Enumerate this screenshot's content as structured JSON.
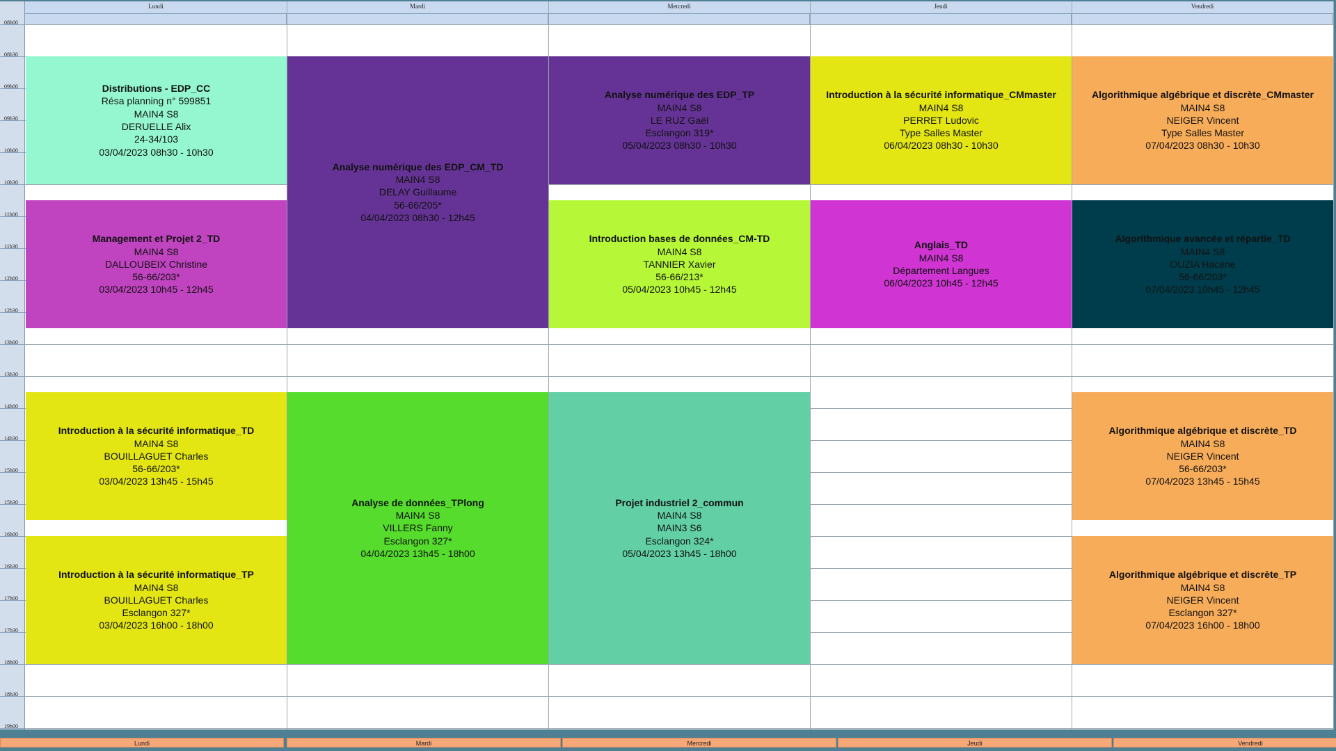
{
  "days": [
    "Lundi",
    "Mardi",
    "Mercredi",
    "Jeudi",
    "Vendredi"
  ],
  "times": [
    "08h00",
    "08h30",
    "09h00",
    "09h30",
    "10h00",
    "10h30",
    "11h00",
    "11h30",
    "12h00",
    "12h30",
    "13h00",
    "13h30",
    "14h00",
    "14h30",
    "15h00",
    "15h30",
    "16h00",
    "16h30",
    "17h00",
    "17h30",
    "18h00",
    "18h30",
    "19h00"
  ],
  "events": [
    {
      "day": 0,
      "start": "08h30",
      "end": "10h30",
      "color": "#94f7cf",
      "title": "Distributions - EDP_CC",
      "lines": [
        "Résa planning n° 599851",
        "MAIN4 S8",
        "DERUELLE Alix",
        "24-34/103",
        "03/04/2023 08h30 - 10h30"
      ]
    },
    {
      "day": 0,
      "start": "10h45",
      "end": "12h45",
      "color": "#c043c0",
      "title": "Management et Projet 2_TD",
      "lines": [
        "MAIN4 S8",
        "DALLOUBEIX Christine",
        "56-66/203*",
        "03/04/2023 10h45 - 12h45"
      ]
    },
    {
      "day": 0,
      "start": "13h45",
      "end": "15h45",
      "color": "#e4e614",
      "title": "Introduction à la sécurité informatique_TD",
      "lines": [
        "MAIN4 S8",
        "BOUILLAGUET Charles",
        "56-66/203*",
        "03/04/2023 13h45 - 15h45"
      ]
    },
    {
      "day": 0,
      "start": "16h00",
      "end": "18h00",
      "color": "#e4e614",
      "title": "Introduction à la sécurité informatique_TP",
      "lines": [
        "MAIN4 S8",
        "BOUILLAGUET Charles",
        "Esclangon 327*",
        "03/04/2023 16h00 - 18h00"
      ]
    },
    {
      "day": 1,
      "start": "08h30",
      "end": "12h45",
      "color": "#653395",
      "title": "Analyse numérique des EDP_CM_TD",
      "lines": [
        "MAIN4 S8",
        "DELAY Guillaume",
        "56-66/205*",
        "04/04/2023 08h30 - 12h45"
      ]
    },
    {
      "day": 1,
      "start": "13h45",
      "end": "18h00",
      "color": "#55dc2d",
      "title": "Analyse de données_TPlong",
      "lines": [
        "MAIN4 S8",
        "VILLERS Fanny",
        "Esclangon 327*",
        "04/04/2023 13h45 - 18h00"
      ]
    },
    {
      "day": 2,
      "start": "08h30",
      "end": "10h30",
      "color": "#653395",
      "title": "Analyse numérique des EDP_TP",
      "lines": [
        "MAIN4 S8",
        "LE RUZ Gaël",
        "Esclangon 319*",
        "05/04/2023 08h30 - 10h30"
      ]
    },
    {
      "day": 2,
      "start": "10h45",
      "end": "12h45",
      "color": "#b6f837",
      "title": "Introduction bases de données_CM-TD",
      "lines": [
        "MAIN4 S8",
        "TANNIER Xavier",
        "56-66/213*",
        "05/04/2023 10h45 - 12h45"
      ]
    },
    {
      "day": 2,
      "start": "13h45",
      "end": "18h00",
      "color": "#62cfa5",
      "title": "Projet industriel 2_commun",
      "lines": [
        "MAIN4 S8",
        "MAIN3 S6",
        "Esclangon 324*",
        "05/04/2023 13h45 - 18h00"
      ]
    },
    {
      "day": 3,
      "start": "08h30",
      "end": "10h30",
      "color": "#e4e614",
      "title": "Introduction à la sécurité informatique_CMmaster",
      "lines": [
        "MAIN4 S8",
        "PERRET Ludovic",
        "Type Salles Master",
        "06/04/2023 08h30 - 10h30"
      ]
    },
    {
      "day": 3,
      "start": "10h45",
      "end": "12h45",
      "color": "#d035d4",
      "title": "Anglais_TD",
      "lines": [
        "MAIN4 S8",
        "Département Langues",
        "06/04/2023 10h45 - 12h45"
      ]
    },
    {
      "day": 4,
      "start": "08h30",
      "end": "10h30",
      "color": "#f7ac5a",
      "title": "Algorithmique algébrique et discrète_CMmaster",
      "lines": [
        "MAIN4 S8",
        "NEIGER Vincent",
        "Type Salles Master",
        "07/04/2023 08h30 - 10h30"
      ]
    },
    {
      "day": 4,
      "start": "10h45",
      "end": "12h45",
      "color": "#003d4c",
      "title": "Algorithmique avancée et répartie_TD",
      "lines": [
        "MAIN4 S8",
        "OUZIA Hacène",
        "56-66/203*",
        "07/04/2023 10h45 - 12h45"
      ]
    },
    {
      "day": 4,
      "start": "13h45",
      "end": "15h45",
      "color": "#f7ac5a",
      "title": "Algorithmique algébrique et discrète_TD",
      "lines": [
        "MAIN4 S8",
        "NEIGER Vincent",
        "56-66/203*",
        "07/04/2023 13h45 - 15h45"
      ]
    },
    {
      "day": 4,
      "start": "16h00",
      "end": "18h00",
      "color": "#f7ac5a",
      "title": "Algorithmique algébrique et discrète_TP",
      "lines": [
        "MAIN4 S8",
        "NEIGER Vincent",
        "Esclangon 327*",
        "07/04/2023 16h00 - 18h00"
      ]
    }
  ],
  "footer_days": [
    "Lundi",
    "Mardi",
    "Mercredi",
    "Jeudi",
    "Vendredi"
  ]
}
